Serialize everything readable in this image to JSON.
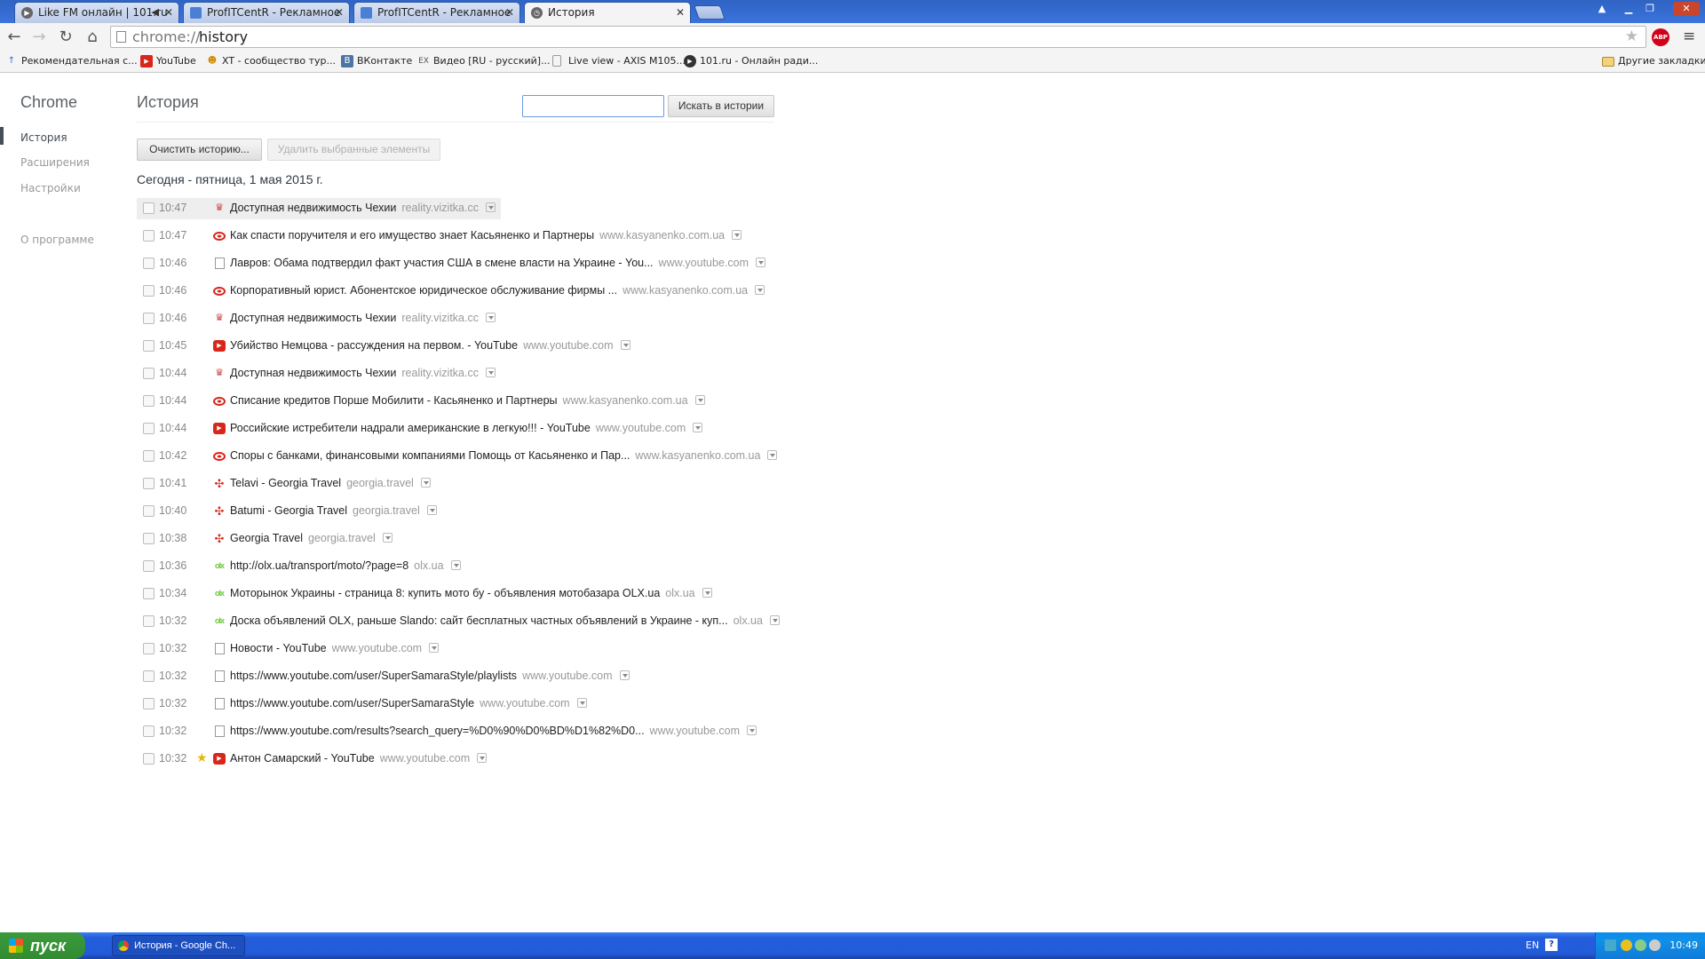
{
  "tabs": [
    {
      "title": "Like FM онлайн | 101.ru",
      "icon": "play-circle-icon",
      "muted_icon": "speaker-muted-icon"
    },
    {
      "title": "ProfITCentR - Рекламное аг",
      "icon": "page-blue-icon"
    },
    {
      "title": "ProfITCentR - Рекламное аг",
      "icon": "page-blue-icon"
    },
    {
      "title": "История",
      "icon": "clock-icon",
      "active": true
    }
  ],
  "toolbar": {
    "url_scheme": "chrome://",
    "url_path": "history",
    "abp_label": "ABP"
  },
  "bookmarks": [
    {
      "label": "Рекомендательная с...",
      "icon": "arrow-up-icon"
    },
    {
      "label": "YouTube",
      "icon": "youtube-icon"
    },
    {
      "label": "XT - сообщество тур...",
      "icon": "person-icon"
    },
    {
      "label": "ВКонтакте",
      "icon": "vk-icon"
    },
    {
      "label": "Видео [RU - русский]...",
      "icon": "ex-icon"
    },
    {
      "label": "Live view - AXIS M105...",
      "icon": "page-icon"
    },
    {
      "label": "101.ru - Онлайн ради...",
      "icon": "play-circle-icon"
    }
  ],
  "other_bookmarks": "Другие закладки",
  "sidebar": {
    "title": "Chrome",
    "items": [
      {
        "label": "История",
        "selected": true
      },
      {
        "label": "Расширения"
      },
      {
        "label": "Настройки"
      },
      {
        "label": "О программе"
      }
    ]
  },
  "main": {
    "title": "История",
    "search_button": "Искать в истории",
    "clear_button": "Очистить историю...",
    "remove_button": "Удалить выбранные элементы",
    "day_header": "Сегодня - пятница, 1 мая 2015 г."
  },
  "entries": [
    {
      "time": "10:47",
      "icon": "crown",
      "title": "Доступная недвижимость Чехии",
      "domain": "reality.vizitka.cc",
      "hover": true
    },
    {
      "time": "10:47",
      "icon": "eye",
      "title": "Как спасти поручителя и его имущество знает Касьяненко и Партнеры",
      "domain": "www.kasyanenko.com.ua"
    },
    {
      "time": "10:46",
      "icon": "doc",
      "title": "Лавров: Обама подтвердил факт участия США в смене власти на Украине - You...",
      "domain": "www.youtube.com"
    },
    {
      "time": "10:46",
      "icon": "eye",
      "title": "Корпоративный юрист. Абонентское юридическое обслуживание фирмы ...",
      "domain": "www.kasyanenko.com.ua"
    },
    {
      "time": "10:46",
      "icon": "crown",
      "title": "Доступная недвижимость Чехии",
      "domain": "reality.vizitka.cc"
    },
    {
      "time": "10:45",
      "icon": "yt",
      "title": "Убийство Немцова - рассуждения на первом. - YouTube",
      "domain": "www.youtube.com"
    },
    {
      "time": "10:44",
      "icon": "crown",
      "title": "Доступная недвижимость Чехии",
      "domain": "reality.vizitka.cc"
    },
    {
      "time": "10:44",
      "icon": "eye",
      "title": "Списание кредитов Порше Мобилити - Касьяненко и Партнеры",
      "domain": "www.kasyanenko.com.ua"
    },
    {
      "time": "10:44",
      "icon": "yt",
      "title": "Российские истребители надрали американские в легкую!!! - YouTube",
      "domain": "www.youtube.com"
    },
    {
      "time": "10:42",
      "icon": "eye",
      "title": "Споры с банками, финансовыми компаниями Помощь от Касьяненко и Пар...",
      "domain": "www.kasyanenko.com.ua"
    },
    {
      "time": "10:41",
      "icon": "georgia",
      "title": "Telavi - Georgia Travel",
      "domain": "georgia.travel"
    },
    {
      "time": "10:40",
      "icon": "georgia",
      "title": "Batumi - Georgia Travel",
      "domain": "georgia.travel"
    },
    {
      "time": "10:38",
      "icon": "georgia",
      "title": "Georgia Travel",
      "domain": "georgia.travel"
    },
    {
      "time": "10:36",
      "icon": "olx",
      "title": "http://olx.ua/transport/moto/?page=8",
      "domain": "olx.ua"
    },
    {
      "time": "10:34",
      "icon": "olx",
      "title": "Моторынок Украины - страница 8: купить мото бу - объявления мотобазара OLX.ua",
      "domain": "olx.ua"
    },
    {
      "time": "10:32",
      "icon": "olx",
      "title": "Доска объявлений OLX, раньше Slando: сайт бесплатных частных объявлений в Украине - куп...",
      "domain": "olx.ua"
    },
    {
      "time": "10:32",
      "icon": "doc",
      "title": "Новости - YouTube",
      "domain": "www.youtube.com"
    },
    {
      "time": "10:32",
      "icon": "doc",
      "title": "https://www.youtube.com/user/SuperSamaraStyle/playlists",
      "domain": "www.youtube.com"
    },
    {
      "time": "10:32",
      "icon": "doc",
      "title": "https://www.youtube.com/user/SuperSamaraStyle",
      "domain": "www.youtube.com"
    },
    {
      "time": "10:32",
      "icon": "doc",
      "title": "https://www.youtube.com/results?search_query=%D0%90%D0%BD%D1%82%D0...",
      "domain": "www.youtube.com"
    },
    {
      "time": "10:32",
      "icon": "yt",
      "title": "Антон Самарский - YouTube",
      "domain": "www.youtube.com",
      "starred": true
    }
  ],
  "taskbar": {
    "start_label": "пуск",
    "task_label": "История - Google Ch...",
    "lang": "EN",
    "clock": "10:49"
  }
}
